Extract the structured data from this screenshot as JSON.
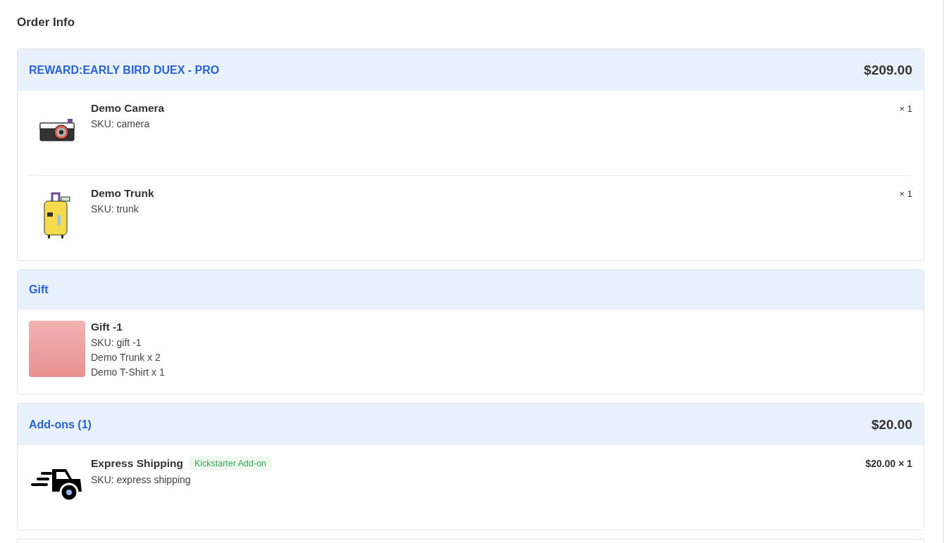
{
  "title": "Order Info",
  "sections": [
    {
      "title": "REWARD:EARLY BIRD DUEX - PRO",
      "price": "$209.00",
      "items": [
        {
          "kind": "camera",
          "name": "Demo Camera",
          "sku": "SKU: camera",
          "quantity": "× 1"
        },
        {
          "kind": "suitcase",
          "name": "Demo Trunk",
          "sku": "SKU: trunk",
          "quantity": "× 1"
        }
      ]
    },
    {
      "title": "Gift",
      "items": [
        {
          "kind": "photo",
          "name": "Gift -1",
          "sku": "SKU: gift -1",
          "lines": [
            "Demo Trunk x 2",
            "Demo T-Shirt x 1"
          ]
        }
      ]
    },
    {
      "title": "Add-ons (1)",
      "price": "$20.00",
      "items": [
        {
          "kind": "truck",
          "name": "Express Shipping",
          "tag": "Kickstarter Add-on",
          "sku": "SKU: express shipping",
          "quantity": "$20.00 × 1"
        }
      ]
    }
  ]
}
